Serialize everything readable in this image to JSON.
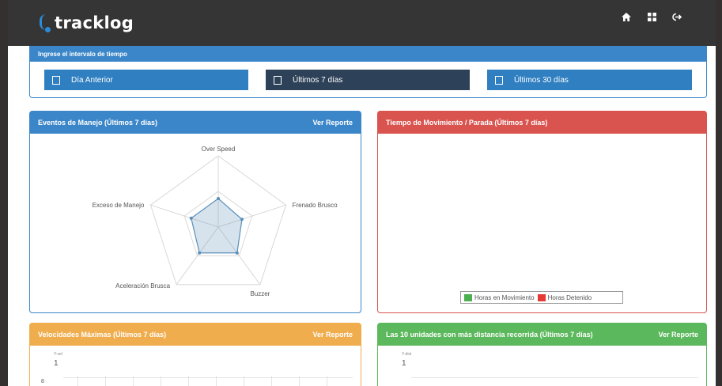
{
  "brand": {
    "name": "tracklog"
  },
  "nav": {
    "icons": [
      "home-icon",
      "grid-icon",
      "logout-icon"
    ]
  },
  "interval": {
    "title": "Ingrese el intervalo de tiempo",
    "buttons": [
      {
        "label": "Día Anterior",
        "color": "#2f7fc1"
      },
      {
        "label": "Últimos 7 días",
        "color": "#2d4258"
      },
      {
        "label": "Últimos 30 días",
        "color": "#2f7fc1"
      }
    ]
  },
  "eventos": {
    "title": "Eventos de Manejo (Últimos 7 días)",
    "link": "Ver Reporte",
    "chart_data": {
      "type": "radar",
      "categories": [
        "Over Speed",
        "Frenado Brusco",
        "Buzzer",
        "Aceleración Brusca",
        "Exceso de Manejo"
      ],
      "values": [
        0.4,
        0.35,
        0.45,
        0.45,
        0.4
      ],
      "grid": true,
      "color": "#5b8fb9"
    }
  },
  "tiempo": {
    "title": "Tiempo de Movimiento / Parada (Últimos 7 días)",
    "legend": [
      {
        "label": "Horas en Movimiento",
        "color": "#4caf50"
      },
      {
        "label": "Horas Detenido",
        "color": "#e53935"
      }
    ]
  },
  "velocidades": {
    "title": "Velocidades Máximas (Últimos 7 días)",
    "link": "Ver Reporte",
    "unit": "Y-vel",
    "tick": "1",
    "tick2": "8"
  },
  "distancia": {
    "title": "Las 10 unidades con más distancia recorrida (Últimos 7 días)",
    "link": "Ver Reporte",
    "unit": "Y-dist",
    "tick": "1"
  }
}
